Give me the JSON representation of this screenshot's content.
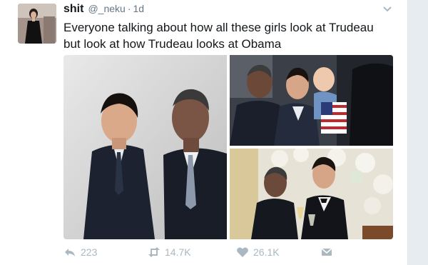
{
  "tweet": {
    "display_name": "shit",
    "handle": "@_neku",
    "separator": "·",
    "time": "1d",
    "text": "Everyone talking about how all these girls look at Trudeau but look at how Trudeau looks at Obama"
  },
  "actions": {
    "replies": "223",
    "retweets": "14.7K",
    "likes": "26.1K"
  },
  "icons": {
    "reply": "reply-icon",
    "retweet": "retweet-icon",
    "like": "heart-icon",
    "dm": "direct-message-icon",
    "more": "chevron-down-icon"
  },
  "colors": {
    "page_background": "#e6ecf0",
    "card_background": "#ffffff",
    "primary_text": "#14171a",
    "secondary_text": "#657786",
    "action_icons": "#aab8c2"
  }
}
